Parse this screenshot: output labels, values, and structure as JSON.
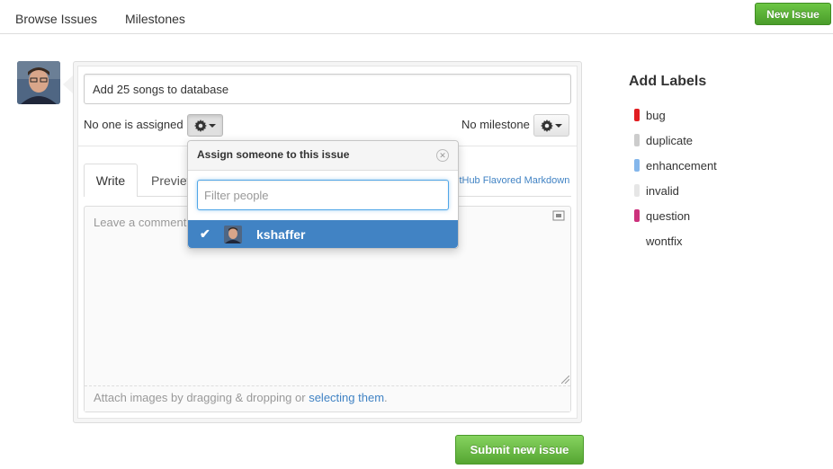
{
  "nav": {
    "browse_issues": "Browse Issues",
    "milestones": "Milestones",
    "new_issue_button": "New Issue"
  },
  "issue_form": {
    "title_value": "Add 25 songs to database",
    "assignee_status": "No one is assigned",
    "milestone_status": "No milestone",
    "tabs": [
      {
        "label": "Write",
        "active": true
      },
      {
        "label": "Preview",
        "active": false
      }
    ],
    "markdown_link": "itHub Flavored Markdown",
    "comment_placeholder": "Leave a comment",
    "attach_text": "Attach images by dragging & dropping or ",
    "attach_link": "selecting them",
    "attach_period": ".",
    "submit_button": "Submit new issue"
  },
  "assign_dropdown": {
    "title": "Assign someone to this issue",
    "filter_placeholder": "Filter people",
    "people": [
      {
        "username": "kshaffer",
        "selected": true
      }
    ]
  },
  "labels": {
    "title": "Add Labels",
    "items": [
      {
        "name": "bug",
        "color": "#e11d21"
      },
      {
        "name": "duplicate",
        "color": "#cccccc"
      },
      {
        "name": "enhancement",
        "color": "#84b6eb"
      },
      {
        "name": "invalid",
        "color": "#e6e6e6"
      },
      {
        "name": "question",
        "color": "#cc317c"
      },
      {
        "name": "wontfix",
        "color": "#ffffff"
      }
    ]
  },
  "colors": {
    "accent_blue": "#4183c4",
    "button_green": "#55a532"
  },
  "icons": {
    "gear": "gear-icon",
    "close": "close-circle-icon",
    "check": "check-icon",
    "fullscreen": "fullscreen-icon"
  }
}
